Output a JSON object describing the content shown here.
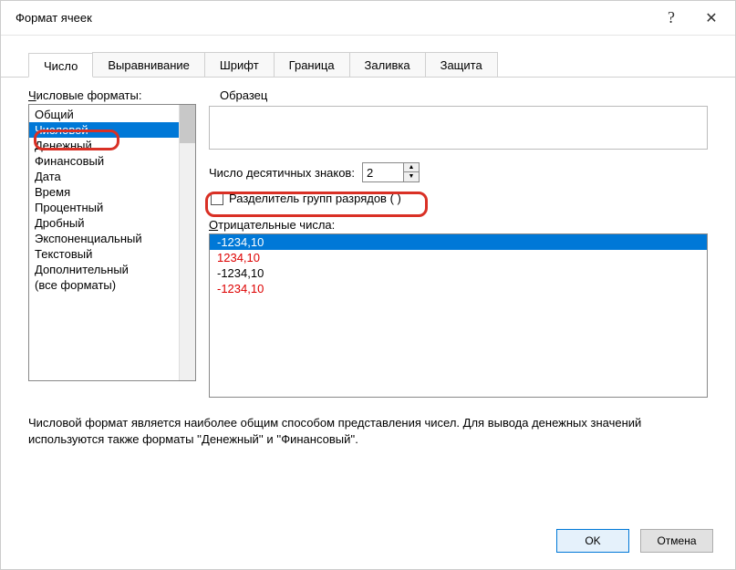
{
  "title": "Формат ячеек",
  "tabs": [
    "Число",
    "Выравнивание",
    "Шрифт",
    "Граница",
    "Заливка",
    "Защита"
  ],
  "formats_label_pre": "Ч",
  "formats_label": "исловые форматы:",
  "formats": [
    "Общий",
    "Числовой",
    "Денежный",
    "Финансовый",
    "Дата",
    "Время",
    "Процентный",
    "Дробный",
    "Экспоненциальный",
    "Текстовый",
    "Дополнительный",
    "(все форматы)"
  ],
  "sample_label": "Образец",
  "decimal_label_pre": "Число десятичных ",
  "decimal_label_u": "з",
  "decimal_label_post": "наков:",
  "decimal_value": "2",
  "separator_label_pre": "Разделитель ",
  "separator_label_u": "г",
  "separator_label_post": "рупп разрядов ( )",
  "negative_label_u": "О",
  "negative_label": "трицательные числа:",
  "negatives": [
    {
      "text": "-1234,10",
      "red": false,
      "selected": true
    },
    {
      "text": "1234,10",
      "red": true,
      "selected": false
    },
    {
      "text": "-1234,10",
      "red": false,
      "selected": false
    },
    {
      "text": "-1234,10",
      "red": true,
      "selected": false
    }
  ],
  "description": "Числовой формат является наиболее общим способом представления чисел. Для вывода денежных значений используются также форматы ''Денежный'' и ''Финансовый''.",
  "ok": "OK",
  "cancel": "Отмена"
}
